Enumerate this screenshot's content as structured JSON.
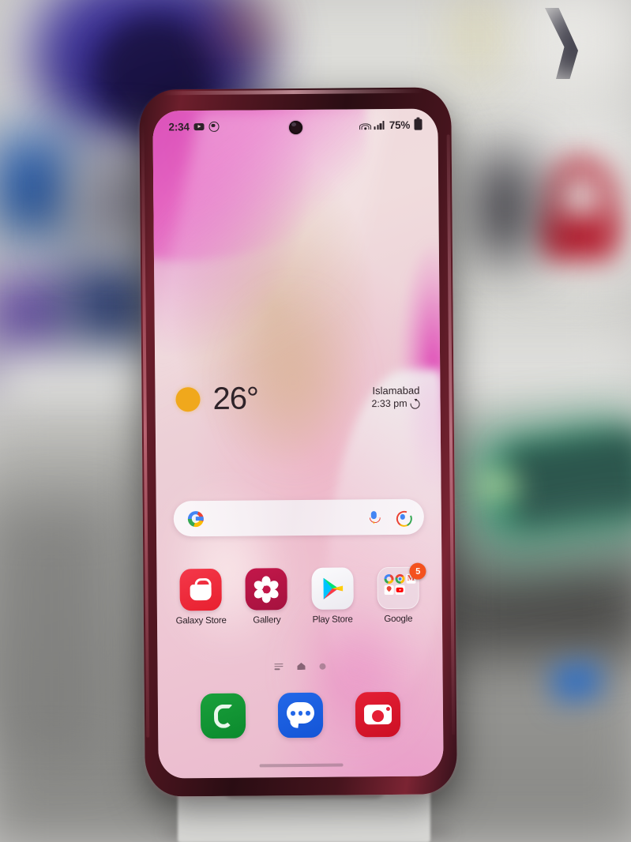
{
  "device": {
    "name": "samsung-galaxy-note-10-aura-red",
    "frame_color": "#541722",
    "screen_state": "home-screen"
  },
  "status_bar": {
    "clock": "2:34",
    "battery_percent": "75%",
    "icons_left": [
      "youtube-icon",
      "screen-recorder-icon"
    ],
    "icons_right": [
      "wifi-icon",
      "signal-icon",
      "battery-icon"
    ]
  },
  "weather_widget": {
    "condition_icon": "sun-icon",
    "temperature": "26",
    "degree_symbol": "°",
    "city": "Islamabad",
    "time": "2:33 pm",
    "refresh_icon": "refresh-icon"
  },
  "search_bar": {
    "logo": "google-g-icon",
    "placeholder": "",
    "value": "",
    "mic_icon": "microphone-icon",
    "lens_icon": "google-lens-icon"
  },
  "apps": [
    {
      "label": "Galaxy Store",
      "icon": "galaxy-store-icon",
      "badge": ""
    },
    {
      "label": "Gallery",
      "icon": "gallery-icon",
      "badge": ""
    },
    {
      "label": "Play Store",
      "icon": "play-store-icon",
      "badge": ""
    },
    {
      "label": "Google",
      "icon": "google-folder-icon",
      "badge": "5"
    }
  ],
  "folder_contents": [
    {
      "label": "Google",
      "glyph": ""
    },
    {
      "label": "Chrome",
      "glyph": ""
    },
    {
      "label": "Gmail",
      "glyph": "M"
    },
    {
      "label": "Maps",
      "glyph": ""
    },
    {
      "label": "YouTube",
      "glyph": ""
    }
  ],
  "page_indicator": {
    "items": [
      "app-list-icon",
      "home-page-icon",
      "page-dot-icon"
    ],
    "active_index": 1
  },
  "dock": [
    {
      "label": "Phone",
      "icon": "phone-icon"
    },
    {
      "label": "Messages",
      "icon": "messages-icon"
    },
    {
      "label": "Camera",
      "icon": "camera-icon"
    }
  ],
  "navigation": {
    "gesture_bar": "home-gesture-bar"
  },
  "colors": {
    "accent_red": "#e8202f",
    "gallery": "#c3174a",
    "phone_green": "#0b8a2d",
    "messages_blue": "#1455d6",
    "camera_red": "#cc0f24",
    "badge_orange": "#f4511e",
    "sun_yellow": "#f0a81c",
    "wallpaper_pink": "#e8b8cc"
  },
  "background_scene": {
    "description": "blurred mobile accessory shop display",
    "items": [
      "blue-speaker",
      "red-headphones-poster",
      "wall-posters",
      "green-tray",
      "glass-counter",
      "white-phone-stand"
    ]
  }
}
